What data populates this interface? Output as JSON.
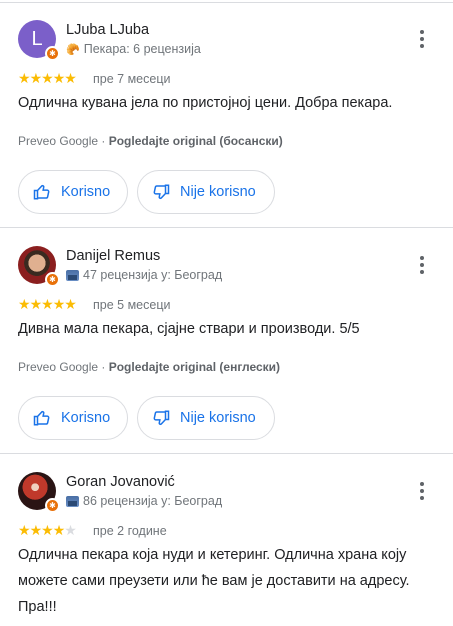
{
  "colors": {
    "accent": "#1a73e8",
    "star": "#fbbc04",
    "star_empty": "#dadce0",
    "avatar_letter_bg": "#7b5fc9",
    "guide_badge": "#e8710a"
  },
  "reviews": [
    {
      "name": "LJuba LJuba",
      "avatar_letter": "L",
      "meta_icon": "bakery-icon",
      "meta": "Пекара: 6 рецензија",
      "rating": 5,
      "time": "пре 7 месеци",
      "text": "Одлична кувана јела по пристојној цени. Добра пекара.",
      "translated_by": "Preveo Google · ",
      "original_link": "Pogledajte original (босански)",
      "useful_label": "Korisno",
      "not_useful_label": "Nije korisno"
    },
    {
      "name": "Danijel Remus",
      "meta_icon": "city-icon",
      "meta": "47 рецензија у: Београд",
      "rating": 5,
      "time": "пре 5 месеци",
      "text": "Дивна мала пекара, сјајне ствари и производи. 5/5",
      "translated_by": "Preveo Google · ",
      "original_link": "Pogledajte original (енглески)",
      "useful_label": "Korisno",
      "not_useful_label": "Nije korisno"
    },
    {
      "name": "Goran Jovanović",
      "meta_icon": "city-icon",
      "meta": "86 рецензија у: Београд",
      "rating": 4,
      "time": "пре 2 године",
      "text": "Одлична пекара која нуди и кетеринг. Одлична храна коју можете сами преузети или ће вам је доставити на адресу. Пра!!!"
    }
  ]
}
